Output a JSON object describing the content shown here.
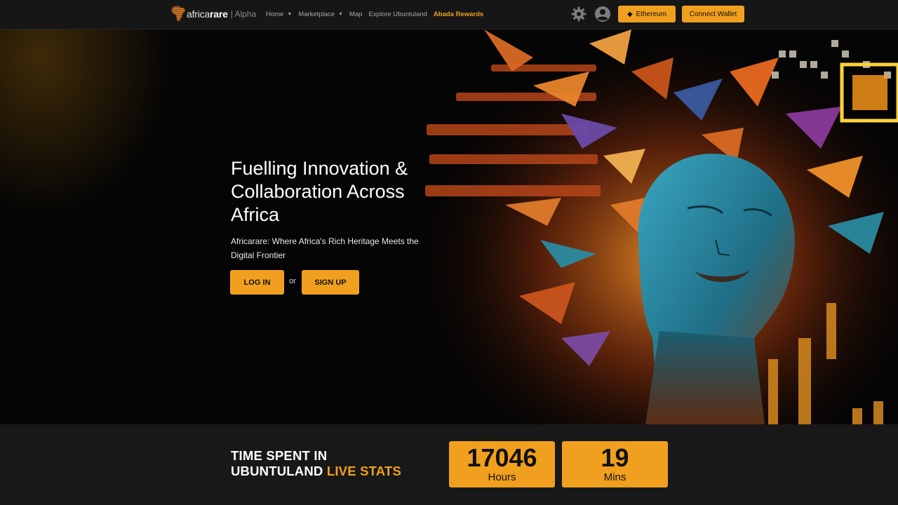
{
  "nav": {
    "logo_prefix": "africa",
    "logo_bold": "rare",
    "logo_suffix": "| Alpha",
    "menu": [
      {
        "label": "Home",
        "dropdown": true
      },
      {
        "label": "Marketplace",
        "dropdown": true
      },
      {
        "label": "Map",
        "dropdown": false
      },
      {
        "label": "Explore Ubuntuland",
        "dropdown": false
      },
      {
        "label": "Abada Rewards",
        "dropdown": false,
        "active": true
      }
    ],
    "icons": [
      "settings-gear-icon",
      "user-account-icon",
      "ethereum-icon"
    ],
    "network_button": "Ethereum",
    "wallet_button": "Connect Wallet"
  },
  "hero": {
    "title": "Fuelling Innovation & Collaboration Across Africa",
    "subtitle": "Africarare: Where Africa's Rich Heritage Meets the Digital Frontier",
    "login_button": "LOG IN",
    "or_text": "or",
    "signup_button": "SIGN UP"
  },
  "stats": {
    "title_line1": "TIME SPENT IN",
    "title_line2": "UBUNTULAND",
    "title_accent": "LIVE STATS",
    "hours_value": "17046",
    "hours_label": "Hours",
    "mins_value": "19",
    "mins_label": "Mins"
  },
  "colors": {
    "accent": "#f0a01e",
    "nav_bg": "#161616",
    "stats_bg": "#181818",
    "hero_bg": "#050505"
  }
}
